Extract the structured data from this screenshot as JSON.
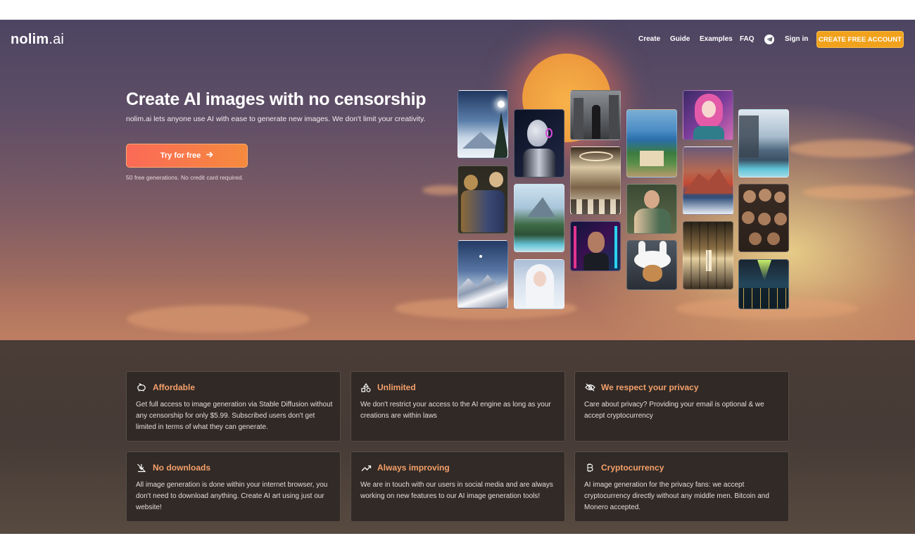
{
  "brand": {
    "name": "nolim",
    "tld": ".ai"
  },
  "nav": {
    "links": [
      "Create",
      "Guide",
      "Examples",
      "FAQ"
    ],
    "telegram_icon": "telegram-icon",
    "sign_in": "Sign in",
    "cta": "CREATE FREE ACCOUNT"
  },
  "hero": {
    "title": "Create AI images with no censorship",
    "subtitle": "nolim.ai lets anyone use AI with ease to generate new images. We don't limit your creativity.",
    "button": "Try for free",
    "note": "50 free generations. No credit card required."
  },
  "gallery": [
    "snowy-mountain-sun",
    "monkey-family-portrait",
    "snowy-peaks-sunset",
    "robot-woman-portrait",
    "modern-villa-pool",
    "white-haired-woman",
    "man-in-ruined-city",
    "grand-hotel-lobby",
    "cyberpunk-bearded-man",
    "mediterranean-villa",
    "renaissance-woman-painting",
    "dog-in-bunny-hat",
    "anime-girl",
    "red-mountain-sunset",
    "luxury-hallway",
    "glass-house-pool",
    "monkey-group",
    "neon-night-city"
  ],
  "features": [
    {
      "icon": "piggy-bank-icon",
      "title": "Affordable",
      "text": "Get full access to image generation via Stable Diffusion without any censorship for only $5.99. Subscribed users don't get limited in terms of what they can generate."
    },
    {
      "icon": "shapes-icon",
      "title": "Unlimited",
      "text": "We don't restrict your access to the AI engine as long as your creations are within laws"
    },
    {
      "icon": "eye-off-icon",
      "title": "We respect your privacy",
      "text": "Care about privacy? Providing your email is optional & we accept cryptocurrency"
    },
    {
      "icon": "no-download-icon",
      "title": "No downloads",
      "text": "All image generation is done within your internet browser, you don't need to download anything. Create AI art using just our website!"
    },
    {
      "icon": "trending-up-icon",
      "title": "Always improving",
      "text": "We are in touch with our users in social media and are always working on new features to our AI image generation tools!"
    },
    {
      "icon": "bitcoin-icon",
      "title": "Cryptocurrency",
      "text": "AI image generation for the privacy fans: we accept cryptocurrency directly without any middle men. Bitcoin and Monero accepted."
    }
  ],
  "colors": {
    "accent": "#f1a21c",
    "button_start": "#fb6a57",
    "button_end": "#f58a3e",
    "feature_title": "#f5a06a"
  }
}
